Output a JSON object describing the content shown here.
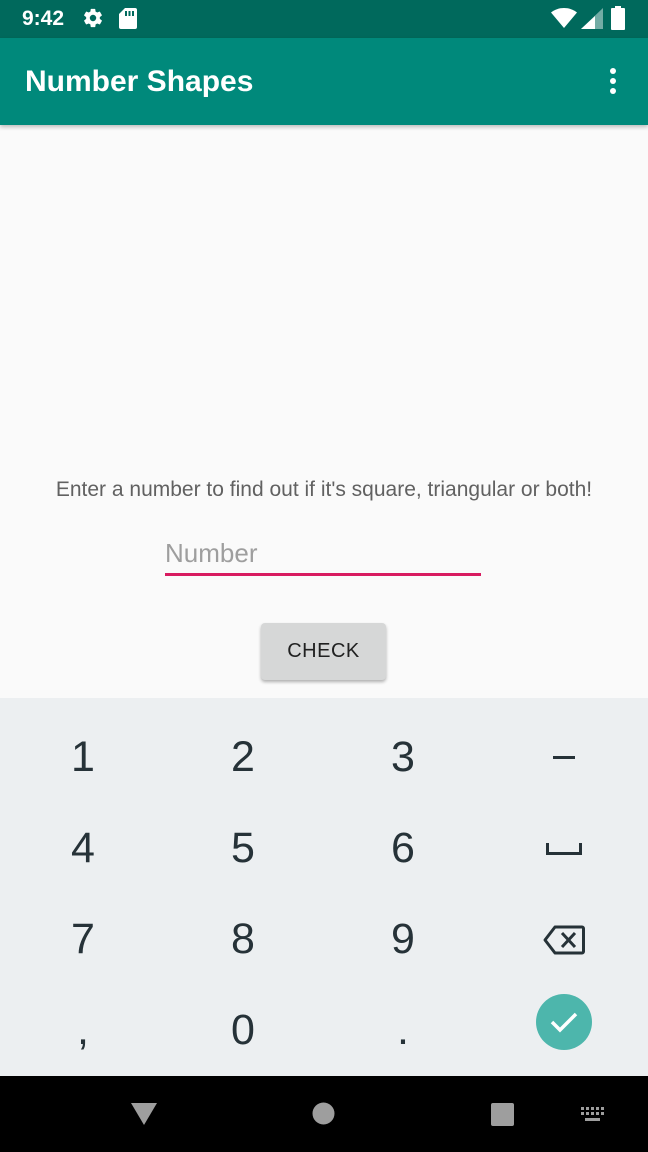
{
  "status_bar": {
    "time": "9:42",
    "icons": [
      "gear-icon",
      "sd-card-icon",
      "wifi-icon",
      "signal-icon",
      "battery-icon"
    ]
  },
  "app_bar": {
    "title": "Number Shapes",
    "overflow_icon": "more-vert-icon"
  },
  "main": {
    "prompt": "Enter a number to find out if it's square, triangular or both!",
    "number_input": {
      "value": "",
      "placeholder": "Number"
    },
    "check_button_label": "CHECK"
  },
  "keyboard": {
    "rows": [
      [
        "1",
        "2",
        "3",
        "-"
      ],
      [
        "4",
        "5",
        "6",
        "space"
      ],
      [
        "7",
        "8",
        "9",
        "backspace"
      ],
      [
        ",",
        "0",
        ".",
        "done"
      ]
    ],
    "keys": {
      "k1": "1",
      "k2": "2",
      "k3": "3",
      "minus": "–",
      "k4": "4",
      "k5": "5",
      "k6": "6",
      "k7": "7",
      "k8": "8",
      "k9": "9",
      "comma": ",",
      "k0": "0",
      "period": "."
    }
  },
  "nav_bar": {
    "icons": [
      "back-icon",
      "home-icon",
      "recents-icon",
      "keyboard-switch-icon"
    ]
  },
  "colors": {
    "status_bar": "#00695c",
    "app_bar": "#00897b",
    "accent": "#d81b60",
    "done_key": "#4db6ac",
    "keyboard_bg": "#eceff1"
  }
}
